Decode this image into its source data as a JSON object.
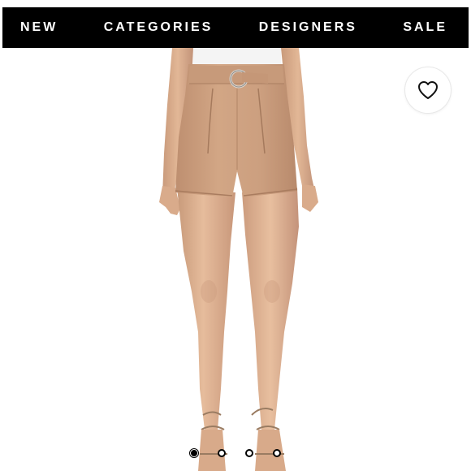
{
  "nav": {
    "items": [
      {
        "label": "NEW"
      },
      {
        "label": "CATEGORIES"
      },
      {
        "label": "DESIGNERS"
      },
      {
        "label": "SALE"
      }
    ]
  },
  "product": {
    "image_icon": "product-photo",
    "shorts_color": "#c99c7b",
    "skin_color": "#ddb08f"
  },
  "wishlist": {
    "icon": "heart-icon"
  },
  "carousel": {
    "total": 4,
    "active_index": 0
  }
}
